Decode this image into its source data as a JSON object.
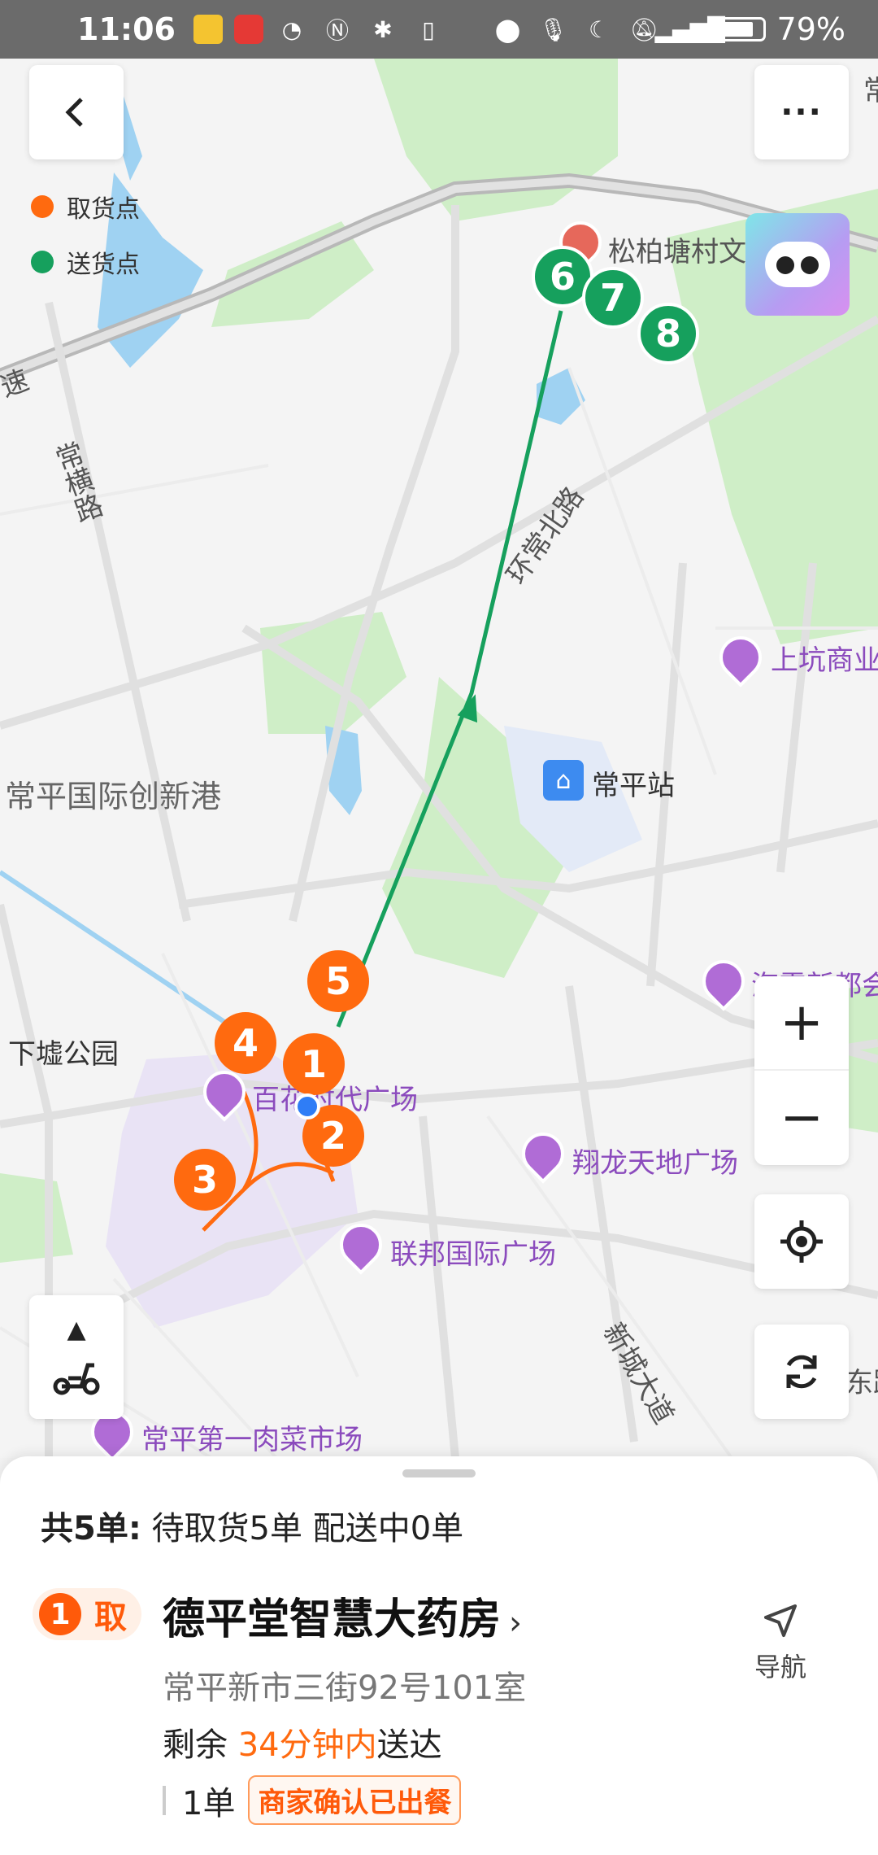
{
  "status_bar": {
    "time": "11:06",
    "battery": "79%",
    "icons": [
      "app-icon",
      "huawei-store-icon",
      "speed-icon",
      "nfc-icon",
      "bluetooth-icon",
      "vibrate-icon",
      "location-icon",
      "mic-icon",
      "moon-icon",
      "mute-icon",
      "signal-icon",
      "battery-icon"
    ]
  },
  "legend": {
    "pickup_label": "取货点",
    "delivery_label": "送货点",
    "pickup_color": "#ff6a0f",
    "delivery_color": "#16a05d"
  },
  "map": {
    "labels": {
      "songbaitang": "松柏塘村文",
      "changheng_road": "常横路",
      "huanchangbei_road": "环常北路",
      "shangkeng": "上坑商业",
      "changping_station": "常平站",
      "changping_innovation": "常平国际创新港",
      "xiaxu_park": "下墟公园",
      "baihe_plaza": "百花时代广场",
      "xianglong_plaza": "翔龙天地广场",
      "lianbang_plaza": "联邦国际广场",
      "haishang": "海霞新都会",
      "first_market": "常平第一肉菜市场",
      "xincheng_road": "新城大道",
      "east_road": "东路",
      "highway": "速",
      "right_top": "常"
    },
    "pickup_markers": [
      "1",
      "2",
      "3",
      "4",
      "5"
    ],
    "delivery_markers": [
      "6",
      "7",
      "8"
    ]
  },
  "controls": {
    "zoom_in": "+",
    "zoom_out": "−"
  },
  "sheet": {
    "summary_total": "共5单:",
    "summary_detail": "待取货5单 配送中0单",
    "badge_number": "1",
    "badge_text": "取",
    "store_name": "德平堂智慧大药房",
    "chevron": "›",
    "address": "常平新市三街92号101室",
    "remain_prefix": "剩余 ",
    "remain_time": "34分钟内",
    "remain_suffix": "送达",
    "order_count": "1单",
    "status_tag": "商家确认已出餐",
    "nav_label": "导航"
  }
}
